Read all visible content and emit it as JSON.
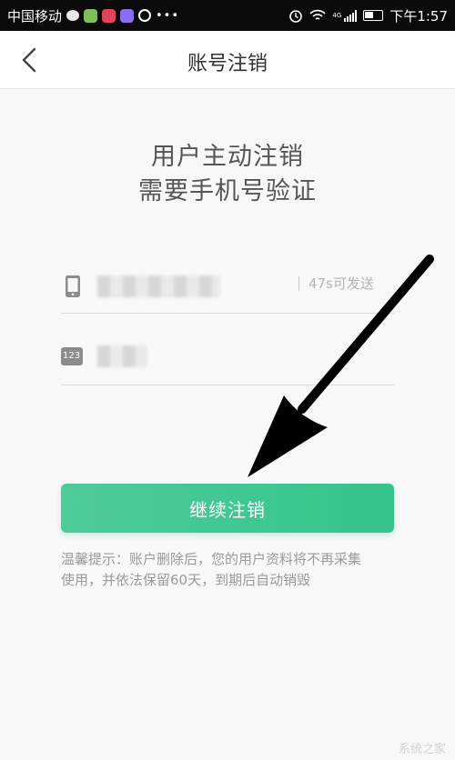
{
  "status_bar": {
    "carrier": "中国移动",
    "network": "4G",
    "time": "下午1:57"
  },
  "nav": {
    "title": "账号注销"
  },
  "heading": {
    "line1": "用户主动注销",
    "line2": "需要手机号验证"
  },
  "form": {
    "code_icon_label": "123",
    "send_code_label": "47s可发送"
  },
  "confirm_button": {
    "label": "继续注销"
  },
  "tip": {
    "line1": "温馨提示：账户删除后，您的用户资料将不再采集",
    "line2": "使用，并依法保留60天，到期后自动销毁"
  },
  "watermark": {
    "text": "系统之家"
  },
  "colors": {
    "accent": "#3ec691",
    "status_bar": "#0a0a0a",
    "tip_text": "#9a9a9a"
  }
}
